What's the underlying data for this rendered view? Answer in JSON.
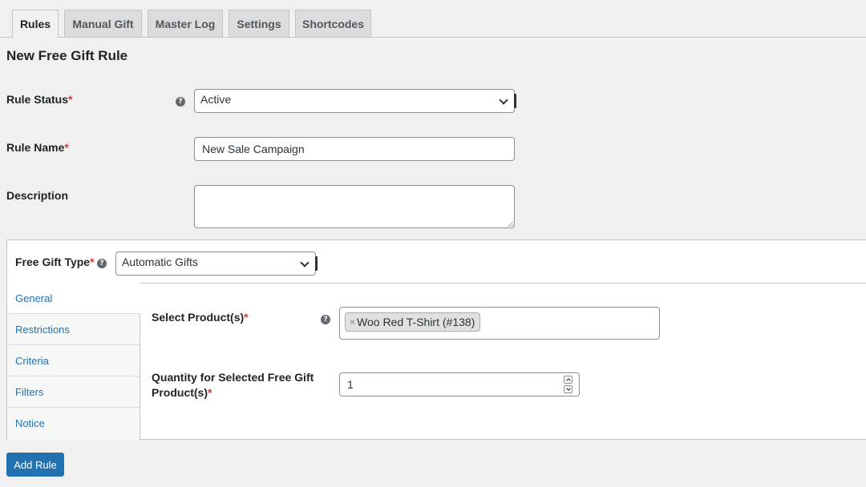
{
  "tabs": [
    {
      "label": "Rules",
      "active": true
    },
    {
      "label": "Manual Gift",
      "active": false
    },
    {
      "label": "Master Log",
      "active": false
    },
    {
      "label": "Settings",
      "active": false
    },
    {
      "label": "Shortcodes",
      "active": false
    }
  ],
  "page_title": "New Free Gift Rule",
  "form": {
    "rule_status": {
      "label": "Rule Status",
      "required": "*",
      "value": "Active",
      "help_icon": "help-icon"
    },
    "rule_name": {
      "label": "Rule Name",
      "required": "*",
      "value": "New Sale Campaign"
    },
    "description": {
      "label": "Description",
      "value": ""
    }
  },
  "panel": {
    "gift_type": {
      "label": "Free Gift Type",
      "required": "*",
      "value": "Automatic Gifts"
    },
    "side_tabs": [
      {
        "label": "General",
        "active": true
      },
      {
        "label": "Restrictions",
        "active": false
      },
      {
        "label": "Criteria",
        "active": false
      },
      {
        "label": "Filters",
        "active": false
      },
      {
        "label": "Notice",
        "active": false
      }
    ],
    "select_products": {
      "label": "Select Product(s)",
      "required": "*",
      "tag_remove": "×",
      "tag": "Woo Red T-Shirt (#138)"
    },
    "quantity": {
      "label_line1": "Quantity for Selected Free Gift",
      "label_line2": "Product(s)",
      "required": "*",
      "value": "1"
    }
  },
  "add_rule_button": "Add Rule",
  "help_glyph": "?",
  "colors": {
    "accent": "#2271b1",
    "required": "#d63638",
    "background": "#f0f0f1"
  }
}
